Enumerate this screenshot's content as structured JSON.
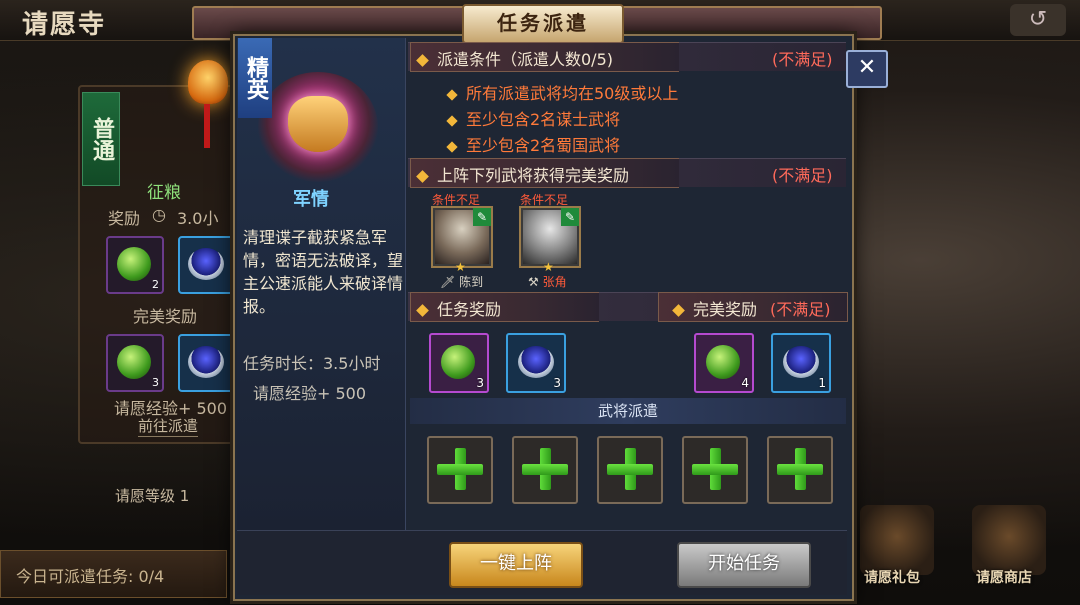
{
  "app": {
    "title": "请愿寺",
    "back_icon": "return-arrow-icon"
  },
  "background": {
    "mission_type": "普通",
    "mission_name": "征粮",
    "reward_label": "奖励",
    "reward_time": "3.0小",
    "reward_items": [
      {
        "icon": "green-gem",
        "count": "2"
      },
      {
        "icon": "blue-ring",
        "count": ""
      }
    ],
    "perfect_reward_label": "完美奖励",
    "perfect_items": [
      {
        "icon": "green-gem",
        "count": "3"
      },
      {
        "icon": "blue-ring",
        "count": ""
      }
    ],
    "exp_text": "请愿经验+ 500",
    "goto_label": "前往派遣",
    "level_text": "请愿等级 1",
    "today_text": "今日可派遣任务: 0/4",
    "shop_items": [
      {
        "label": "请愿礼包"
      },
      {
        "label": "请愿商店"
      }
    ]
  },
  "modal": {
    "title": "任务派遣",
    "close_icon": "close-x-icon",
    "elite_tag": "精英",
    "mission_name": "军情",
    "description": "清理谍子截获紧急军情，密语无法破译，望主公速派能人来破译情报。",
    "duration": "任务时长：3.5小时",
    "exp": "请愿经验+ 500",
    "conditions_header": "派遣条件（派遣人数0/5)",
    "conditions_status": "(不满足)",
    "conditions": [
      "所有派遣武将均在50级或以上",
      "至少包含2名谋士武将",
      "至少包含2名蜀国武将"
    ],
    "perfect_header": "上阵下列武将获得完美奖励",
    "perfect_status": "(不满足)",
    "generals": [
      {
        "warning": "条件不足",
        "name": "陈到",
        "stars": "★"
      },
      {
        "warning": "条件不足",
        "name": "张角",
        "stars": "★"
      }
    ],
    "task_reward_header": "任务奖励",
    "task_rewards": [
      {
        "icon": "green-gem",
        "count": "3"
      },
      {
        "icon": "blue-ring",
        "count": "3"
      }
    ],
    "perfect_reward_header": "完美奖励",
    "perfect_reward_status": "(不满足)",
    "perfect_rewards": [
      {
        "icon": "green-gem",
        "count": "4"
      },
      {
        "icon": "blue-ring",
        "count": "1"
      }
    ],
    "dispatch_label": "武将派遣",
    "dispatch_slots": 5,
    "btn_auto": "一键上阵",
    "btn_start": "开始任务"
  }
}
